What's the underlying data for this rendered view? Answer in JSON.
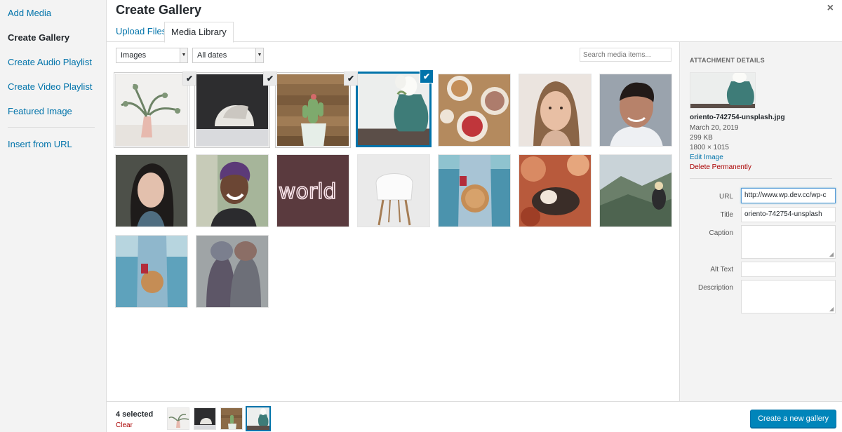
{
  "menu": {
    "items": [
      {
        "label": "Add Media"
      },
      {
        "label": "Create Gallery"
      },
      {
        "label": "Create Audio Playlist"
      },
      {
        "label": "Create Video Playlist"
      },
      {
        "label": "Featured Image"
      }
    ],
    "insert_url": "Insert from URL"
  },
  "header": {
    "title": "Create Gallery",
    "close": "×"
  },
  "tabs": [
    {
      "label": "Upload Files"
    },
    {
      "label": "Media Library"
    }
  ],
  "toolbar": {
    "type_filter": "Images",
    "date_filter": "All dates",
    "search_placeholder": "Search media items..."
  },
  "details": {
    "heading": "ATTACHMENT DETAILS",
    "filename": "oriento-742754-unsplash.jpg",
    "date": "March 20, 2019",
    "size": "299 KB",
    "dimensions": "1800 × 1015",
    "edit_link": "Edit Image",
    "delete_link": "Delete Permanently",
    "fields": {
      "url_label": "URL",
      "url_value": "http://www.wp.dev.cc/wp-c",
      "title_label": "Title",
      "title_value": "oriento-742754-unsplash",
      "caption_label": "Caption",
      "alt_label": "Alt Text",
      "description_label": "Description"
    }
  },
  "bottom": {
    "count": "4 selected",
    "clear": "Clear",
    "button": "Create a new gallery"
  },
  "colors": {
    "accent": "#0073aa",
    "danger": "#a00000",
    "primary_button": "#0085ba"
  }
}
